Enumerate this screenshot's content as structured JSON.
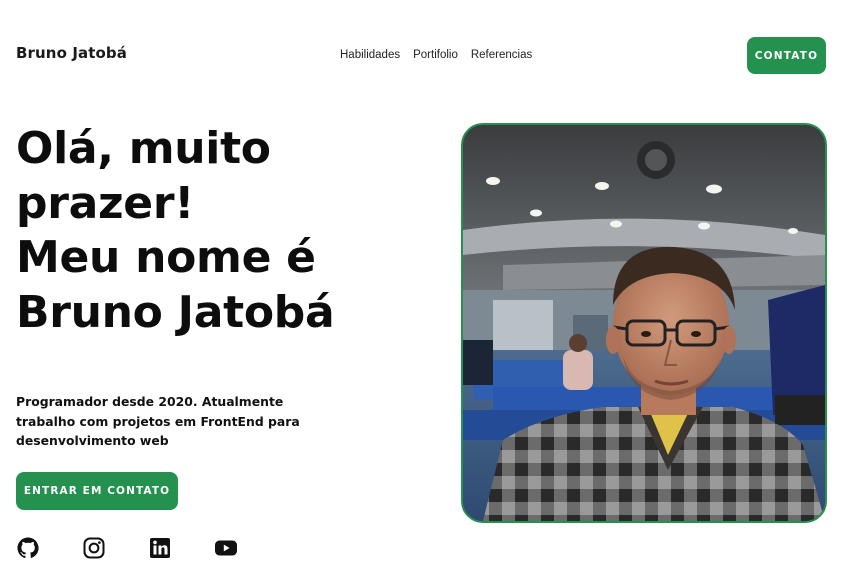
{
  "header": {
    "brand": "Bruno Jatobá",
    "nav": [
      "Habilidades",
      "Portifolio",
      "Referencias"
    ],
    "contact_button": "CONTATO"
  },
  "hero": {
    "title_lines": [
      "Olá, muito",
      "prazer!",
      "Meu nome é",
      "Bruno Jatobá"
    ],
    "subtitle": "Programador desde 2020. Atualmente trabalho com projetos em FrontEnd para desenvolvimento web",
    "cta_button": "ENTRAR EM CONTATO"
  },
  "social_icons": [
    "github-icon",
    "instagram-icon",
    "linkedin-icon",
    "youtube-icon"
  ],
  "colors": {
    "accent": "#24914f",
    "text": "#111111",
    "background": "#ffffff"
  }
}
